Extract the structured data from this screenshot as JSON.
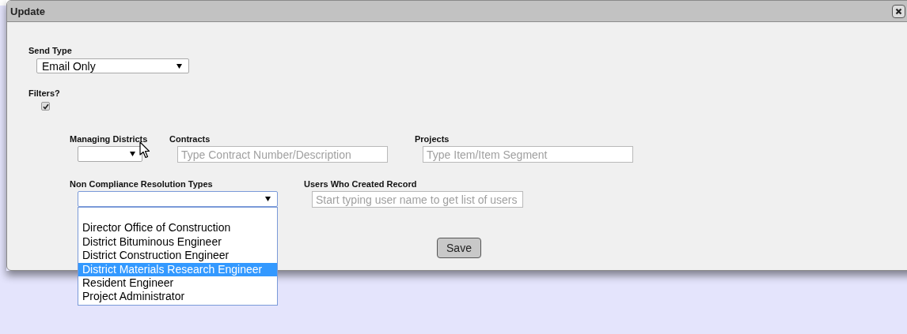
{
  "dialog": {
    "title": "Update",
    "send_type": {
      "label": "Send Type",
      "value": "Email Only"
    },
    "filters": {
      "label": "Filters?",
      "checked": true
    },
    "managing_districts": {
      "label": "Managing Districts"
    },
    "contracts": {
      "label": "Contracts",
      "placeholder": "Type Contract Number/Description"
    },
    "projects": {
      "label": "Projects",
      "placeholder": "Type Item/Item Segment"
    },
    "resolution_types": {
      "label": "Non Compliance Resolution Types",
      "expanded": true,
      "options": [
        {
          "kind": "blank",
          "selected": false
        },
        {
          "kind": "text",
          "label": "Director Office of Construction",
          "selected": false
        },
        {
          "kind": "text",
          "label": "District Bituminous Engineer",
          "selected": false
        },
        {
          "kind": "text",
          "label": "District Construction Engineer",
          "selected": false
        },
        {
          "kind": "text",
          "label": "District Materials Research Engineer",
          "selected": true
        },
        {
          "kind": "text",
          "label": "Resident Engineer",
          "selected": false
        },
        {
          "kind": "text",
          "label": "Project Administrator",
          "selected": false
        }
      ]
    },
    "users": {
      "label": "Users Who Created Record",
      "placeholder": "Start typing user name to get list of users"
    },
    "save_button": "Save"
  }
}
